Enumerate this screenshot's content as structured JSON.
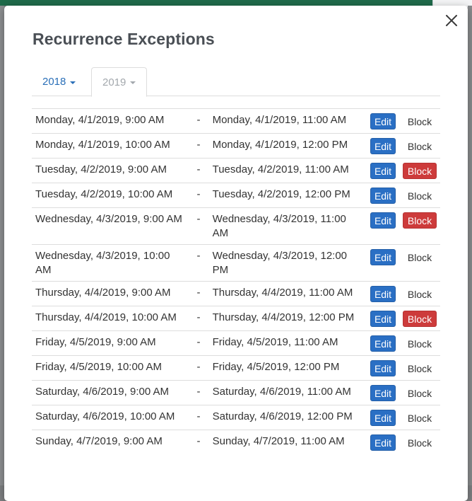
{
  "modal": {
    "title": "Recurrence Exceptions",
    "close_glyph": "×"
  },
  "tabs": [
    {
      "label": "2018",
      "active": false
    },
    {
      "label": "2019",
      "active": true
    }
  ],
  "rows": [
    {
      "start": "Monday, 4/1/2019, 9:00 AM",
      "separator": "-",
      "end": "Monday, 4/1/2019, 11:00 AM",
      "edit_label": "Edit",
      "block_label": "Block",
      "blocked": false
    },
    {
      "start": "Monday, 4/1/2019, 10:00 AM",
      "separator": "-",
      "end": "Monday, 4/1/2019, 12:00 PM",
      "edit_label": "Edit",
      "block_label": "Block",
      "blocked": false
    },
    {
      "start": "Tuesday, 4/2/2019, 9:00 AM",
      "separator": "-",
      "end": "Tuesday, 4/2/2019, 11:00 AM",
      "edit_label": "Edit",
      "block_label": "Block",
      "blocked": true
    },
    {
      "start": "Tuesday, 4/2/2019, 10:00 AM",
      "separator": "-",
      "end": "Tuesday, 4/2/2019, 12:00 PM",
      "edit_label": "Edit",
      "block_label": "Block",
      "blocked": false
    },
    {
      "start": "Wednesday, 4/3/2019, 9:00 AM",
      "separator": "-",
      "end": "Wednesday, 4/3/2019, 11:00 AM",
      "edit_label": "Edit",
      "block_label": "Block",
      "blocked": true
    },
    {
      "start": "Wednesday, 4/3/2019, 10:00 AM",
      "separator": "-",
      "end": "Wednesday, 4/3/2019, 12:00 PM",
      "edit_label": "Edit",
      "block_label": "Block",
      "blocked": false
    },
    {
      "start": "Thursday, 4/4/2019, 9:00 AM",
      "separator": "-",
      "end": "Thursday, 4/4/2019, 11:00 AM",
      "edit_label": "Edit",
      "block_label": "Block",
      "blocked": false
    },
    {
      "start": "Thursday, 4/4/2019, 10:00 AM",
      "separator": "-",
      "end": "Thursday, 4/4/2019, 12:00 PM",
      "edit_label": "Edit",
      "block_label": "Block",
      "blocked": true
    },
    {
      "start": "Friday, 4/5/2019, 9:00 AM",
      "separator": "-",
      "end": "Friday, 4/5/2019, 11:00 AM",
      "edit_label": "Edit",
      "block_label": "Block",
      "blocked": false
    },
    {
      "start": "Friday, 4/5/2019, 10:00 AM",
      "separator": "-",
      "end": "Friday, 4/5/2019, 12:00 PM",
      "edit_label": "Edit",
      "block_label": "Block",
      "blocked": false
    },
    {
      "start": "Saturday, 4/6/2019, 9:00 AM",
      "separator": "-",
      "end": "Saturday, 4/6/2019, 11:00 AM",
      "edit_label": "Edit",
      "block_label": "Block",
      "blocked": false
    },
    {
      "start": "Saturday, 4/6/2019, 10:00 AM",
      "separator": "-",
      "end": "Saturday, 4/6/2019, 12:00 PM",
      "edit_label": "Edit",
      "block_label": "Block",
      "blocked": false
    },
    {
      "start": "Sunday, 4/7/2019, 9:00 AM",
      "separator": "-",
      "end": "Sunday, 4/7/2019, 11:00 AM",
      "edit_label": "Edit",
      "block_label": "Block",
      "blocked": false
    }
  ],
  "colors": {
    "edit_button": "#2a6fc4",
    "block_active": "#cd3b3b",
    "tab_link": "#2a6fb8",
    "tab_inactive_text": "#a3a8ad",
    "title": "#4a4f55"
  },
  "icons": {
    "close": "close-icon",
    "caret": "caret-down-icon"
  }
}
